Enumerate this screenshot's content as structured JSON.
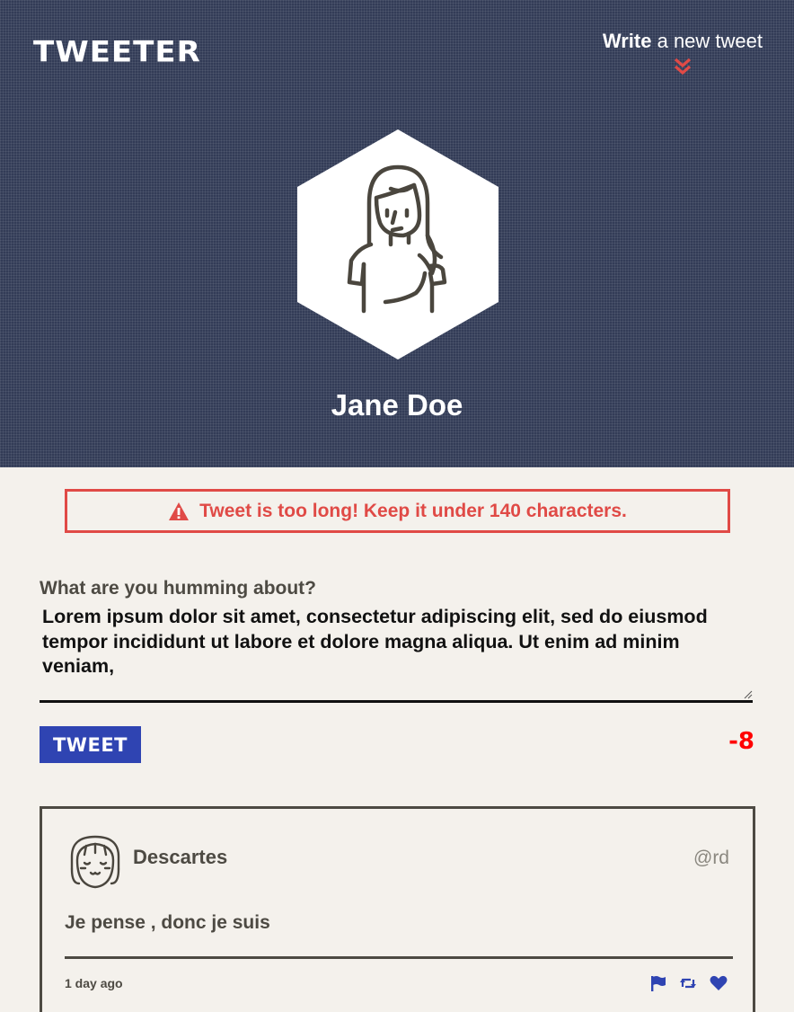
{
  "header": {
    "logo": "TWEETER",
    "compose_bold": "Write",
    "compose_rest": " a new tweet",
    "profile_name": "Jane Doe"
  },
  "error": {
    "message": "Tweet is too long! Keep it under 140 characters."
  },
  "compose": {
    "label": "What are you humming about?",
    "value": "Lorem ipsum dolor sit amet, consectetur adipiscing elit, sed do eiusmod tempor incididunt ut labore et dolore magna aliqua. Ut enim ad minim veniam,",
    "submit_label": "TWEET",
    "counter": "-8"
  },
  "tweets": [
    {
      "name": "Descartes",
      "handle": "@rd",
      "text": "Je pense , donc je suis",
      "time": "1 day ago"
    }
  ],
  "colors": {
    "header_bg": "#333c57",
    "page_bg": "#f4f1ec",
    "accent_red": "#e04a46",
    "button_blue": "#2f44b2",
    "counter_red": "#ff0000"
  },
  "icons": {
    "compose": "double-chevron-down-icon",
    "warning": "warning-icon",
    "flag": "flag-icon",
    "retweet": "retweet-icon",
    "like": "heart-icon"
  }
}
